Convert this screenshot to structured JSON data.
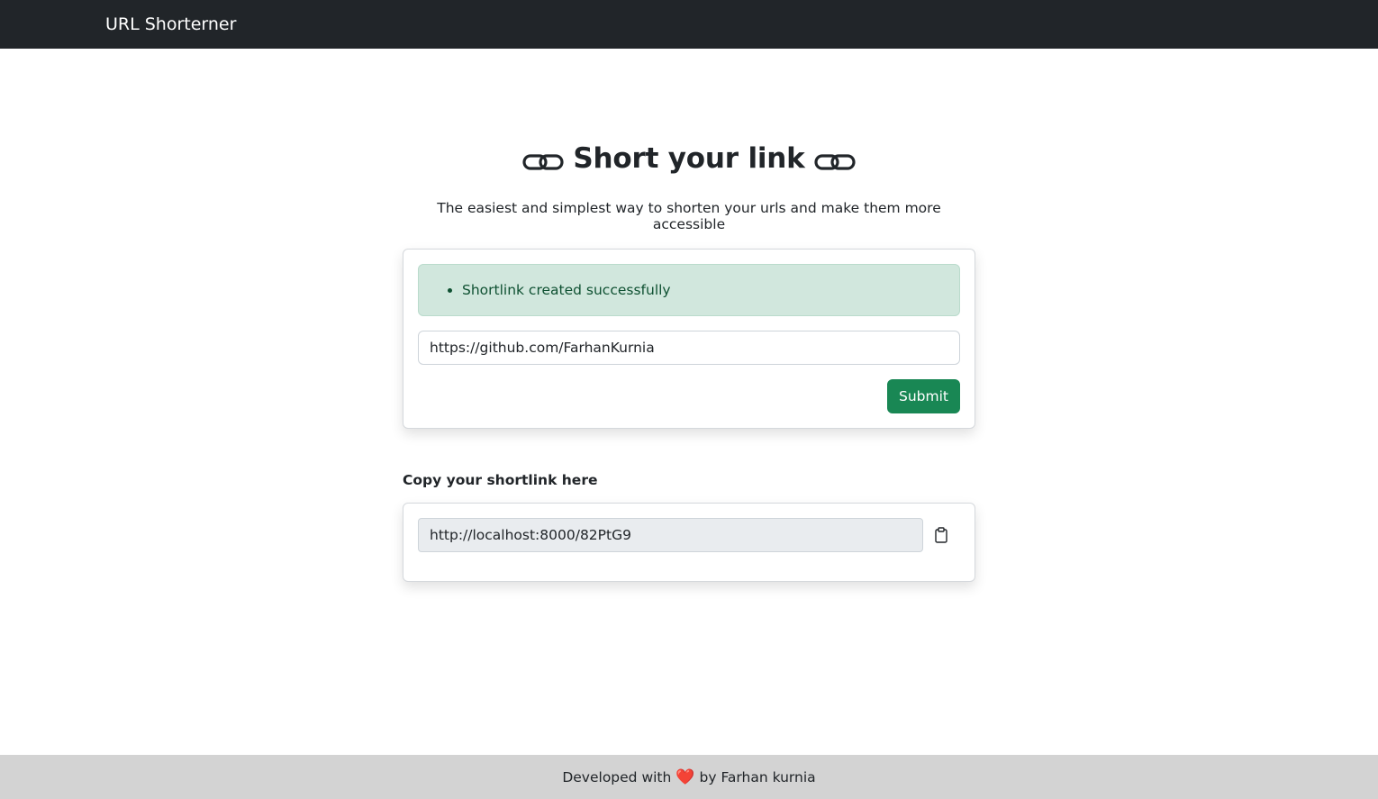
{
  "navbar": {
    "brand": "URL Shorterner"
  },
  "main": {
    "title": "Short your link",
    "subtitle": "The easiest and simplest way to shorten your urls and make them more accessible",
    "alert": {
      "message": "Shortlink created successfully",
      "color": "#d1e7dd"
    },
    "url_input": {
      "value": "https://github.com/FarhanKurnia",
      "placeholder": ""
    },
    "submit_label": "Submit",
    "copy_label": "Copy your shortlink here",
    "shortlink": {
      "value": "http://localhost:8000/82PtG9"
    }
  },
  "footer": {
    "prefix": "Developed with",
    "heart": "❤️",
    "suffix": "by Farhan kurnia"
  },
  "colors": {
    "accent": "#198754",
    "navbar": "#212529",
    "footer": "#d3d3d3"
  },
  "icons": {
    "title_left": "link-icon",
    "title_right": "link-icon",
    "copy": "clipboard-icon"
  }
}
